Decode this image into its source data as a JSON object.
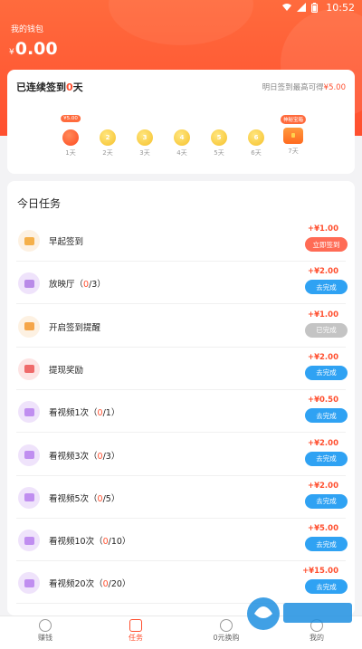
{
  "status_bar": {
    "time": "10:52"
  },
  "wallet": {
    "label": "我的钱包",
    "currency": "¥",
    "amount": "0.00"
  },
  "checkin": {
    "prefix": "已连续签到",
    "days": "0",
    "suffix": "天",
    "note_prefix": "明日签到最高可得",
    "note_amount": "¥5.00",
    "items": [
      {
        "label": "1天",
        "coin": "",
        "tag": "¥5.00",
        "today": true
      },
      {
        "label": "2天",
        "coin": "2"
      },
      {
        "label": "3天",
        "coin": "3"
      },
      {
        "label": "4天",
        "coin": "4"
      },
      {
        "label": "5天",
        "coin": "5"
      },
      {
        "label": "6天",
        "coin": "6"
      },
      {
        "label": "7天",
        "tag": "神秘宝箱",
        "chest": true
      }
    ]
  },
  "tasks": {
    "title": "今日任务",
    "items": [
      {
        "name": "早起签到",
        "count": "",
        "reward": "+¥1.00",
        "button": "立即签到",
        "style": "red",
        "icon_color": "#fdf1e2",
        "inner_color": "#f5b04a"
      },
      {
        "name": "放映厅（",
        "count": "0",
        "total": "/3）",
        "reward": "+¥2.00",
        "button": "去完成",
        "style": "blue",
        "icon_color": "#efe3fb",
        "inner_color": "#b98ae8"
      },
      {
        "name": "开启签到提醒",
        "count": "",
        "reward": "+¥1.00",
        "button": "已完成",
        "style": "gray",
        "icon_color": "#fdf1e2",
        "inner_color": "#f5a64a"
      },
      {
        "name": "提现奖励",
        "count": "",
        "reward": "+¥2.00",
        "button": "去完成",
        "style": "blue",
        "icon_color": "#fde4e4",
        "inner_color": "#ef6a6a"
      },
      {
        "name": "看视频1次（",
        "count": "0",
        "total": "/1）",
        "reward": "+¥0.50",
        "button": "去完成",
        "style": "blue",
        "icon_color": "#efe3fb",
        "inner_color": "#c08ef0"
      },
      {
        "name": "看视频3次（",
        "count": "0",
        "total": "/3）",
        "reward": "+¥2.00",
        "button": "去完成",
        "style": "blue",
        "icon_color": "#efe3fb",
        "inner_color": "#c08ef0"
      },
      {
        "name": "看视频5次（",
        "count": "0",
        "total": "/5）",
        "reward": "+¥2.00",
        "button": "去完成",
        "style": "blue",
        "icon_color": "#efe3fb",
        "inner_color": "#c08ef0"
      },
      {
        "name": "看视频10次（",
        "count": "0",
        "total": "/10）",
        "reward": "+¥5.00",
        "button": "去完成",
        "style": "blue",
        "icon_color": "#efe3fb",
        "inner_color": "#c08ef0"
      },
      {
        "name": "看视频20次（",
        "count": "0",
        "total": "/20）",
        "reward": "+¥15.00",
        "button": "去完成",
        "style": "blue",
        "icon_color": "#efe3fb",
        "inner_color": "#c08ef0"
      }
    ]
  },
  "nav": {
    "items": [
      {
        "label": "赚钱",
        "active": false
      },
      {
        "label": "任务",
        "active": true
      },
      {
        "label": "0元换购",
        "active": false
      },
      {
        "label": "我的",
        "active": false
      }
    ]
  },
  "colors": {
    "accent": "#ff4f2f",
    "blue": "#2fa2f3",
    "gray": "#c4c4c4"
  }
}
